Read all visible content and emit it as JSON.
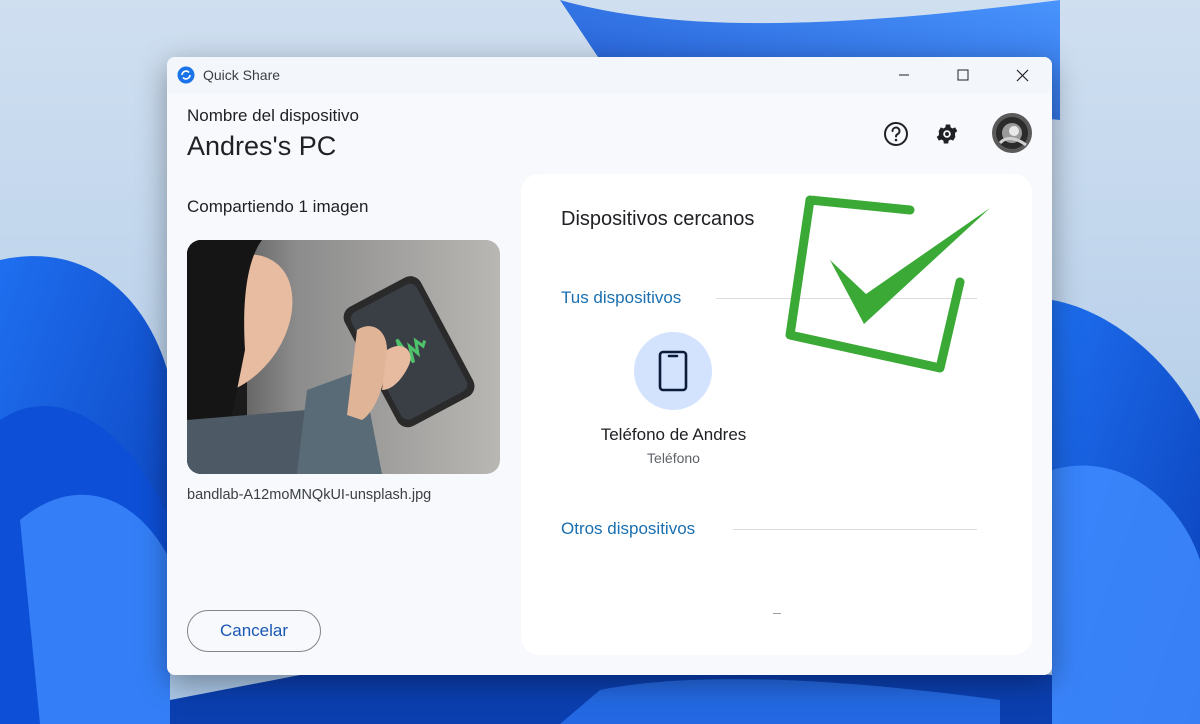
{
  "window": {
    "title": "Quick Share",
    "controls": {
      "minimize": "minimize-icon",
      "maximize": "maximize-icon",
      "close": "close-icon"
    }
  },
  "header": {
    "device_caption": "Nombre del dispositivo",
    "device_name": "Andres's PC",
    "icons": [
      "help-icon",
      "gear-icon",
      "avatar"
    ]
  },
  "share": {
    "title": "Compartiendo 1 imagen",
    "file_name": "bandlab-A12moMNQkUI-unsplash.jpg",
    "cancel_label": "Cancelar"
  },
  "nearby": {
    "title": "Dispositivos cercanos",
    "your_devices_label": "Tus dispositivos",
    "other_devices_label": "Otros dispositivos",
    "devices": [
      {
        "name": "Teléfono de Andres",
        "type": "Teléfono",
        "icon": "phone-icon"
      }
    ]
  },
  "colors": {
    "accent_blue": "#1a6fb0",
    "button_text": "#1a57b3",
    "device_circle": "#d3e3fd",
    "checkmark_green": "#3aa935"
  }
}
